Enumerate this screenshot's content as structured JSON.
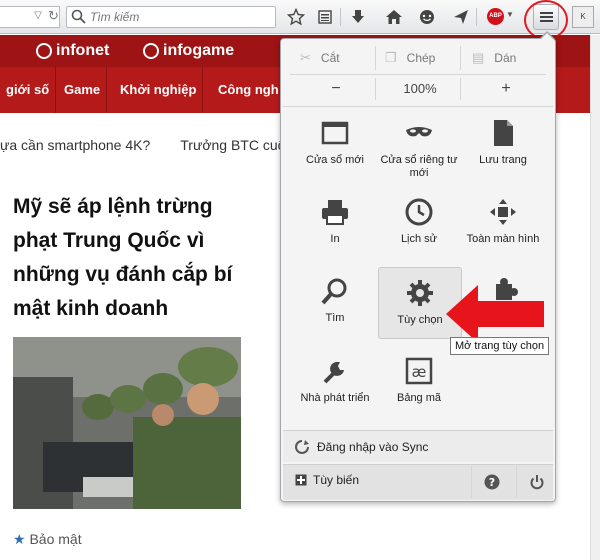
{
  "toolbar": {
    "search_placeholder": "Tìm kiếm",
    "abp_label": "ABP",
    "extra_button": "K",
    "highlight_color": "#e11a22"
  },
  "site": {
    "logos": [
      "infonet",
      "infogame"
    ],
    "nav": [
      "giới số",
      "Game",
      "Khởi nghiệp",
      "Công ngh"
    ],
    "ticker": [
      "ựa cần smartphone 4K?",
      "Trưởng BTC cuộ"
    ],
    "headline": "Mỹ sẽ áp lệnh trừng phạt Trung Quốc vì những vụ đánh cắp bí mật kinh doanh",
    "tag": "Bảo mật",
    "brand_color": "#b51a1a"
  },
  "menu": {
    "edit": {
      "cut": "Cắt",
      "copy": "Chép",
      "paste": "Dán"
    },
    "zoom": {
      "minus": "−",
      "level": "100%",
      "plus": "+"
    },
    "items": [
      {
        "label": "Cửa sổ mới",
        "icon": "new-window-icon"
      },
      {
        "label": "Cửa sổ riêng tư mới",
        "icon": "private-window-icon"
      },
      {
        "label": "Lưu trang",
        "icon": "save-page-icon"
      },
      {
        "label": "In",
        "icon": "print-icon"
      },
      {
        "label": "Lịch sử",
        "icon": "history-icon"
      },
      {
        "label": "Toàn màn hình",
        "icon": "fullscreen-icon"
      },
      {
        "label": "Tìm",
        "icon": "find-icon"
      },
      {
        "label": "Tùy chọn",
        "icon": "gear-icon"
      },
      {
        "label": "",
        "icon": "addons-icon"
      },
      {
        "label": "Nhà phát triển",
        "icon": "developer-icon"
      },
      {
        "label": "Bảng mã",
        "icon": "encoding-icon"
      }
    ],
    "sync": "Đăng nhập vào Sync",
    "customize": "Tùy biến",
    "tooltip": "Mở trang tùy chọn"
  }
}
